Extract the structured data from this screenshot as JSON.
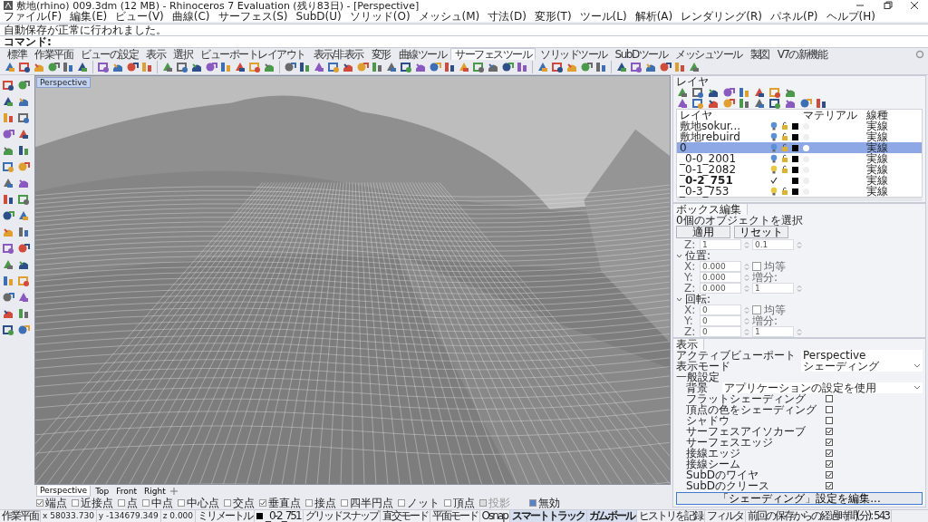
{
  "window": {
    "title": "敷地(rhino) 009.3dm (12 MB) - Rhinoceros 7 Evaluation (残り83日) - [Perspective]"
  },
  "menu": [
    "ファイル(F)",
    "編集(E)",
    "ビュー(V)",
    "曲線(C)",
    "サーフェス(S)",
    "SubD(U)",
    "ソリッド(O)",
    "メッシュ(M)",
    "寸法(D)",
    "変形(T)",
    "ツール(L)",
    "解析(A)",
    "レンダリング(R)",
    "パネル(P)",
    "ヘルプ(H)"
  ],
  "command_history": [
    "自動保存が正常に行われました。"
  ],
  "command_prompt": "コマンド:",
  "toolbar_tabs": [
    {
      "label": "標準",
      "selected": false
    },
    {
      "label": "作業平面",
      "selected": false
    },
    {
      "label": "ビューの設定",
      "selected": false
    },
    {
      "label": "表示",
      "selected": false
    },
    {
      "label": "選択",
      "selected": false
    },
    {
      "label": "ビューポートレイアウト",
      "selected": false
    },
    {
      "label": "表示/非表示",
      "selected": false
    },
    {
      "label": "変形",
      "selected": false
    },
    {
      "label": "曲線ツール",
      "selected": false
    },
    {
      "label": "サーフェスツール",
      "selected": true
    },
    {
      "label": "ソリッドツール",
      "selected": false
    },
    {
      "label": "SubDツール",
      "selected": false
    },
    {
      "label": "メッシュツール",
      "selected": false
    },
    {
      "label": "製図",
      "selected": false
    },
    {
      "label": "V7の新機能",
      "selected": false
    }
  ],
  "viewport": {
    "title": "Perspective"
  },
  "viewport_tabs": [
    {
      "label": "Perspective",
      "selected": true
    },
    {
      "label": "Top",
      "selected": false
    },
    {
      "label": "Front",
      "selected": false
    },
    {
      "label": "Right",
      "selected": false
    }
  ],
  "layers": {
    "title": "レイヤ",
    "columns": [
      "レイヤ",
      "マテリアル",
      "線種"
    ],
    "rows": [
      {
        "name": "敷地sokur...",
        "selected": false,
        "current": false,
        "color": "#5b8fd6",
        "linetype": "実線"
      },
      {
        "name": "敷地rebuird",
        "selected": false,
        "current": false,
        "color": "#5b8fd6",
        "linetype": "実線"
      },
      {
        "name": "0",
        "selected": true,
        "current": false,
        "color": "#5b8fd6",
        "linetype": "実線"
      },
      {
        "name": "_0-0_2001",
        "selected": false,
        "current": false,
        "color": "#5b8fd6",
        "linetype": "実線"
      },
      {
        "name": "_0-1_2082",
        "selected": false,
        "current": false,
        "color": "#e8c840",
        "linetype": "実線"
      },
      {
        "name": "_0-2_751",
        "selected": false,
        "current": true,
        "linetype": "実線"
      },
      {
        "name": "_0-3_753",
        "selected": false,
        "current": false,
        "color": "#e8c840",
        "linetype": "実線"
      }
    ]
  },
  "box_edit": {
    "title": "ボックス編集",
    "selection": "0個のオブジェクトを選択",
    "buttons": [
      "適用",
      "リセット"
    ],
    "rows": [
      {
        "kind": "field",
        "axis": "Z:",
        "value": "1",
        "side": {
          "kind": "spin",
          "value": "0.1"
        }
      },
      {
        "kind": "section",
        "label": "位置:",
        "expanded": true
      },
      {
        "kind": "field",
        "axis": "X:",
        "value": "0.000",
        "side": {
          "kind": "check",
          "label": "均等",
          "checked": false
        }
      },
      {
        "kind": "field",
        "axis": "Y:",
        "value": "0.000",
        "side": {
          "kind": "label",
          "label": "増分:"
        }
      },
      {
        "kind": "field",
        "axis": "Z:",
        "value": "0.000",
        "side": {
          "kind": "spin",
          "value": "1"
        }
      },
      {
        "kind": "section",
        "label": "回転:",
        "expanded": true
      },
      {
        "kind": "field",
        "axis": "X:",
        "value": "0",
        "side": {
          "kind": "check",
          "label": "均等",
          "checked": false
        }
      },
      {
        "kind": "field",
        "axis": "Y:",
        "value": "0",
        "side": {
          "kind": "label",
          "label": "増分:"
        }
      },
      {
        "kind": "field",
        "axis": "Z:",
        "value": "0",
        "side": {
          "kind": "spin",
          "value": "1"
        }
      }
    ]
  },
  "display": {
    "title": "表示",
    "rows": [
      {
        "kind": "value",
        "label": "アクティブビューポート",
        "value": "Perspective"
      },
      {
        "kind": "dropdown",
        "label": "表示モード",
        "value": "シェーディング"
      },
      {
        "kind": "group",
        "label": "一般設定",
        "children": [
          {
            "kind": "dropdown",
            "label": "背景",
            "value": "アプリケーションの設定を使用"
          },
          {
            "kind": "check",
            "label": "フラットシェーディング",
            "checked": false
          },
          {
            "kind": "check",
            "label": "頂点の色をシェーディング",
            "checked": false
          },
          {
            "kind": "check",
            "label": "シャドウ",
            "checked": false
          },
          {
            "kind": "check",
            "label": "サーフェスアイソカーブ",
            "checked": true
          },
          {
            "kind": "check",
            "label": "サーフェスエッジ",
            "checked": true
          },
          {
            "kind": "check",
            "label": "接線エッジ",
            "checked": true
          },
          {
            "kind": "check",
            "label": "接線シーム",
            "checked": true
          },
          {
            "kind": "check",
            "label": "SubDのワイヤ",
            "checked": true
          },
          {
            "kind": "check",
            "label": "SubDのクリース",
            "checked": true
          }
        ]
      }
    ],
    "button": "「シェーディング」設定を編集..."
  },
  "osnaps": [
    {
      "label": "端点",
      "checked": true,
      "disabled": false
    },
    {
      "label": "近接点",
      "checked": false,
      "disabled": false
    },
    {
      "label": "点",
      "checked": false,
      "disabled": false
    },
    {
      "label": "中点",
      "checked": false,
      "disabled": false
    },
    {
      "label": "中心点",
      "checked": false,
      "disabled": false
    },
    {
      "label": "交点",
      "checked": false,
      "disabled": false
    },
    {
      "label": "垂直点",
      "checked": true,
      "disabled": false
    },
    {
      "label": "接点",
      "checked": false,
      "disabled": false
    },
    {
      "label": "四半円点",
      "checked": false,
      "disabled": false
    },
    {
      "label": "ノット",
      "checked": false,
      "disabled": false
    },
    {
      "label": "頂点",
      "checked": false,
      "disabled": false
    },
    {
      "label": "投影",
      "checked": false,
      "disabled": true
    }
  ],
  "osnap_disable": {
    "label": "無効",
    "checked": true
  },
  "status_bar": [
    {
      "kind": "plain",
      "text": "作業平面"
    },
    {
      "kind": "plain",
      "text": "x 58033.730"
    },
    {
      "kind": "plain",
      "text": "y -134679.349"
    },
    {
      "kind": "plain",
      "text": "z 0.000"
    },
    {
      "kind": "plain",
      "text": "ミリメートル"
    },
    {
      "kind": "layer",
      "text": "_0-2_751"
    },
    {
      "kind": "toggle",
      "text": "グリッドスナップ",
      "on": false
    },
    {
      "kind": "toggle",
      "text": "直交モード",
      "on": false
    },
    {
      "kind": "toggle",
      "text": "平面モード",
      "on": false
    },
    {
      "kind": "toggle",
      "text": "Osnap",
      "on": false
    },
    {
      "kind": "toggle",
      "text": "スマートトラック",
      "on": true
    },
    {
      "kind": "toggle",
      "text": "ガムボール",
      "on": true
    },
    {
      "kind": "toggle",
      "text": "ヒストリを記録",
      "on": false
    },
    {
      "kind": "toggle",
      "text": "フィルタ",
      "on": false
    },
    {
      "kind": "plain",
      "text": "前回の保存からの経過時間(分): 543"
    }
  ]
}
